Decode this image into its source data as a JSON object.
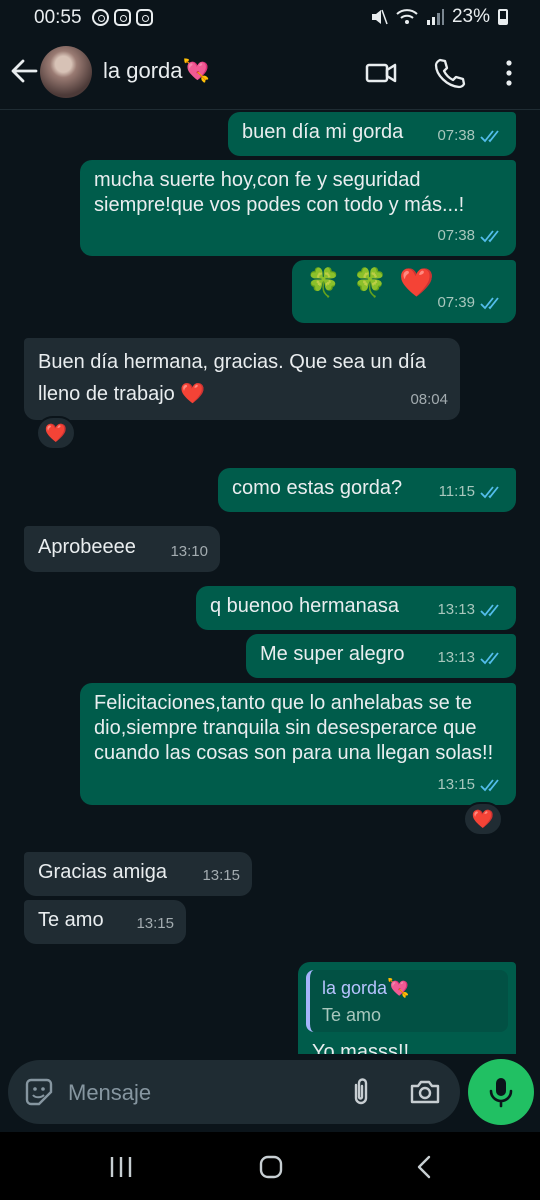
{
  "status_bar": {
    "time": "00:55",
    "battery": "23%"
  },
  "header": {
    "contact_name": "la gorda",
    "contact_emoji": "💘"
  },
  "messages": [
    {
      "text": "buen día mi gorda",
      "time": "07:38"
    },
    {
      "text": "mucha suerte hoy,con fe y seguridad siempre!que vos podes con todo y más...!",
      "time": "07:38"
    },
    {
      "text": "🍀 🍀 ❤️",
      "time": "07:39"
    },
    {
      "text": "Buen día hermana, gracias. Que sea un día lleno de trabajo ❤️",
      "time": "08:04",
      "reaction": "❤️"
    },
    {
      "text": "como estas gorda?",
      "time": "11:15"
    },
    {
      "text": "Aprobeeee",
      "time": "13:10"
    },
    {
      "text": "q buenoo hermanasa",
      "time": "13:13"
    },
    {
      "text": "Me super alegro",
      "time": "13:13"
    },
    {
      "text": "Felicitaciones,tanto que lo anhelabas se te dio,siempre tranquila sin desesperarce que cuando las cosas son para una llegan solas!!",
      "time": "13:15",
      "reaction": "❤️"
    },
    {
      "text": "Gracias amiga",
      "time": "13:15"
    },
    {
      "text": "Te amo",
      "time": "13:15"
    },
    {
      "text": "Yo masss!!",
      "quote_author": "la gorda💘",
      "quote_text": "Te amo"
    }
  ],
  "input": {
    "placeholder": "Mensaje"
  },
  "colors": {
    "outgoing_bubble": "#005c4b",
    "incoming_bubble": "#202c33",
    "background": "#0b141a",
    "accent": "#21c063",
    "read_ticks": "#53bdeb"
  }
}
